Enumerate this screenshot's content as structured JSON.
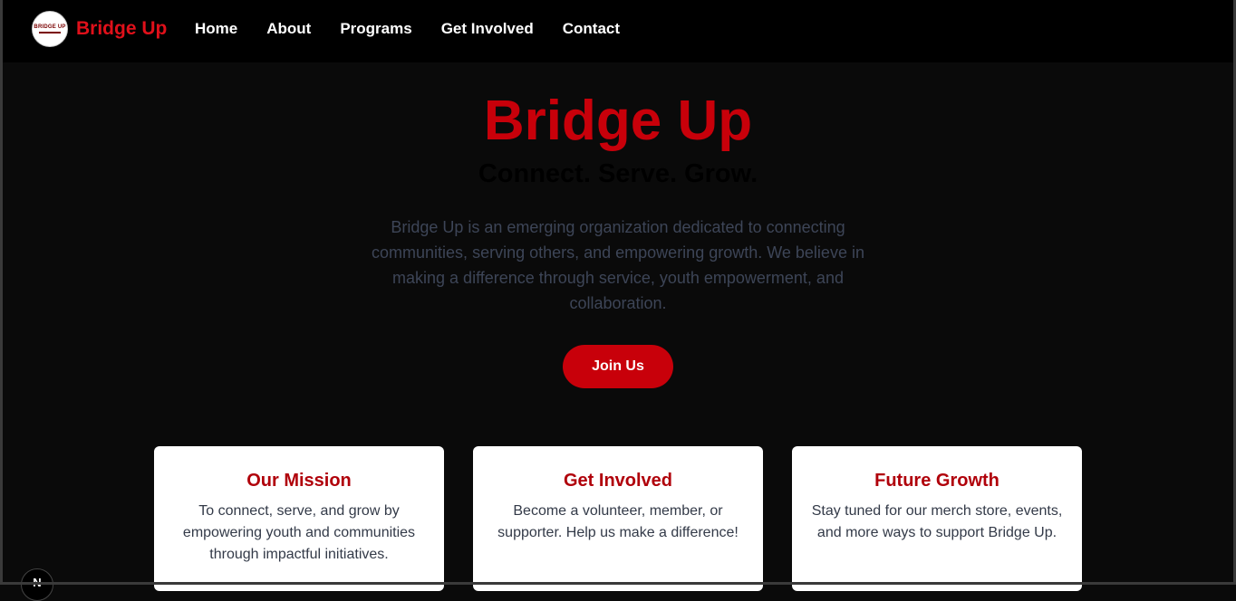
{
  "nav": {
    "logo_text": "BRIDGE UP",
    "brand": "Bridge Up",
    "links": [
      "Home",
      "About",
      "Programs",
      "Get Involved",
      "Contact"
    ]
  },
  "hero": {
    "title": "Bridge Up",
    "subtitle": "Connect. Serve. Grow.",
    "description": "Bridge Up is an emerging organization dedicated to connecting communities, serving others, and empowering growth. We believe in making a difference through service, youth empowerment, and collaboration.",
    "button": "Join Us"
  },
  "cards": [
    {
      "title": "Our Mission",
      "text": "To connect, serve, and grow by empowering youth and communities through impactful initiatives."
    },
    {
      "title": "Get Involved",
      "text": "Become a volunteer, member, or supporter. Help us make a difference!"
    },
    {
      "title": "Future Growth",
      "text": "Stay tuned for our merch store, events, and more ways to support Bridge Up."
    }
  ],
  "floating_badge": "N",
  "colors": {
    "accent": "#c8000a",
    "brand": "#e0101a",
    "background": "#0a0a0a",
    "navbar": "#000000"
  }
}
